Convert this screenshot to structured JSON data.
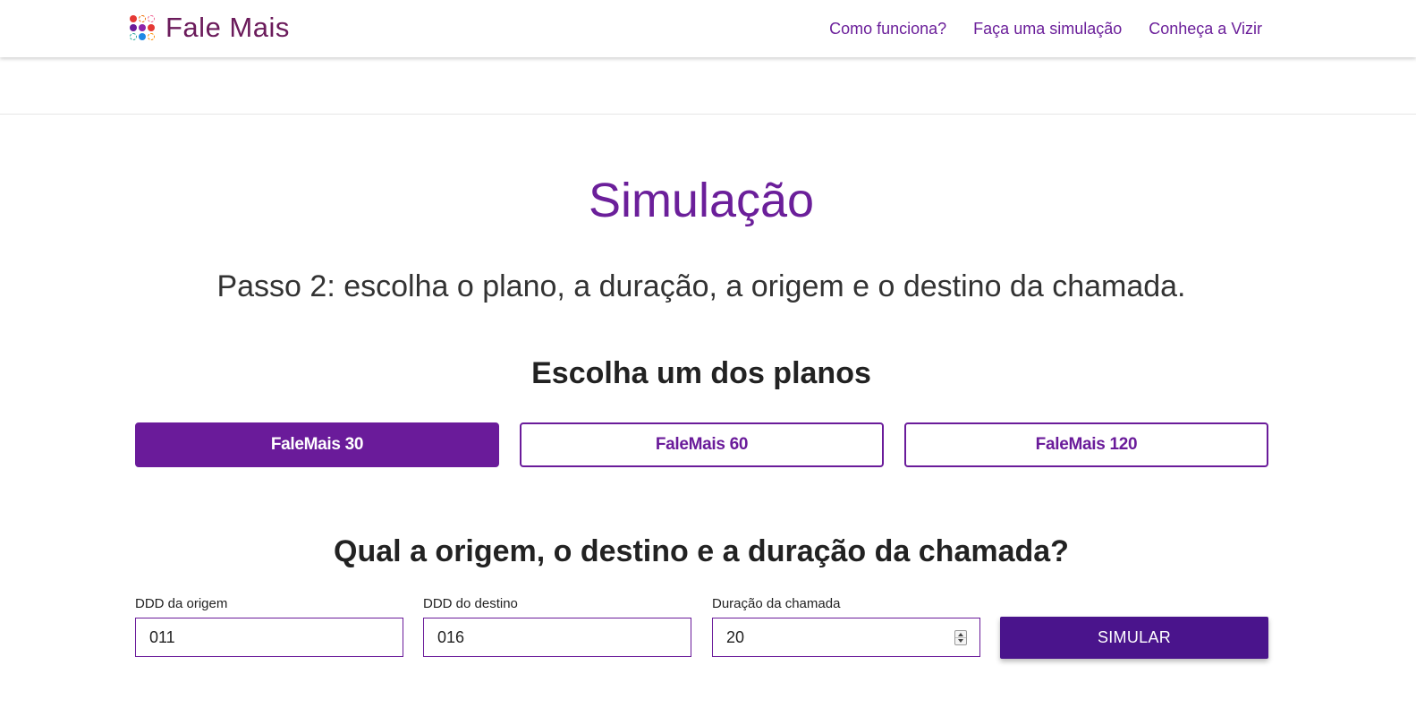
{
  "header": {
    "brand": "Fale Mais",
    "logo_icon": "dotted-circles-logo-icon",
    "nav": [
      "Como funciona?",
      "Faça uma simulação",
      "Conheça a Vizir"
    ],
    "accent": "#6b1f9a"
  },
  "main": {
    "title": "Simulação",
    "step": "Passo 2: escolha o plano, a duração, a origem e o destino da chamada.",
    "plans_title": "Escolha um dos planos",
    "plans": [
      {
        "label": "FaleMais 30",
        "selected": true
      },
      {
        "label": "FaleMais 60",
        "selected": false
      },
      {
        "label": "FaleMais 120",
        "selected": false
      }
    ],
    "question": "Qual a origem, o destino e a duração da chamada?",
    "fields": [
      {
        "label": "DDD da origem",
        "value": "011"
      },
      {
        "label": "DDD do destino",
        "value": "016"
      },
      {
        "label": "Duração da chamada",
        "value": "20"
      }
    ],
    "submit_label": "SIMULAR",
    "colors": {
      "primary": "#6a1b9a",
      "button": "#4a148c"
    }
  }
}
